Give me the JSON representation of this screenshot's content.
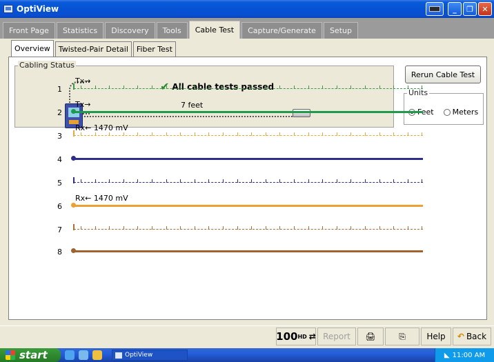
{
  "window": {
    "title": "OptiView"
  },
  "main_tabs": [
    "Front Page",
    "Statistics",
    "Discovery",
    "Tools",
    "Cable Test",
    "Capture/Generate",
    "Setup"
  ],
  "active_main_tab": "Cable Test",
  "sub_tabs": [
    "Overview",
    "Twisted-Pair Detail",
    "Fiber Test"
  ],
  "active_sub_tab": "Overview",
  "cabling_status": {
    "legend": "Cabling Status",
    "message": "All cable tests passed",
    "length": "7 feet"
  },
  "rerun_label": "Rerun Cable Test",
  "units": {
    "legend": "Units",
    "feet": "Feet",
    "meters": "Meters",
    "selected": "Feet"
  },
  "pairs": [
    {
      "num": "1",
      "label": "Tx→",
      "style": "dashed",
      "color": "#3a9a4a"
    },
    {
      "num": "2",
      "label": "Tx→",
      "style": "solid",
      "color": "#1f9a4c"
    },
    {
      "num": "3",
      "label": "Rx← 1470 mV",
      "style": "dashed",
      "color": "#e8a840"
    },
    {
      "num": "4",
      "label": "",
      "style": "solid",
      "color": "#2e2d8c"
    },
    {
      "num": "5",
      "label": "",
      "style": "dashed",
      "color": "#2e2d8c"
    },
    {
      "num": "6",
      "label": "Rx← 1470 mV",
      "style": "solid",
      "color": "#eba231"
    },
    {
      "num": "7",
      "label": "",
      "style": "dashed",
      "color": "#a87038"
    },
    {
      "num": "8",
      "label": "",
      "style": "solid",
      "color": "#a0622e"
    }
  ],
  "statusbar": {
    "speed": "100",
    "speed_unit": "HD",
    "report": "Report",
    "help": "Help",
    "back": "Back"
  },
  "taskbar": {
    "start": "start",
    "task": "OptiView",
    "clock": "11:00 AM"
  },
  "icons": {
    "app": "optiview-app-icon",
    "check": "check-icon",
    "keyboard": "keyboard-icon",
    "print": "print-icon",
    "network": "network-icon"
  }
}
